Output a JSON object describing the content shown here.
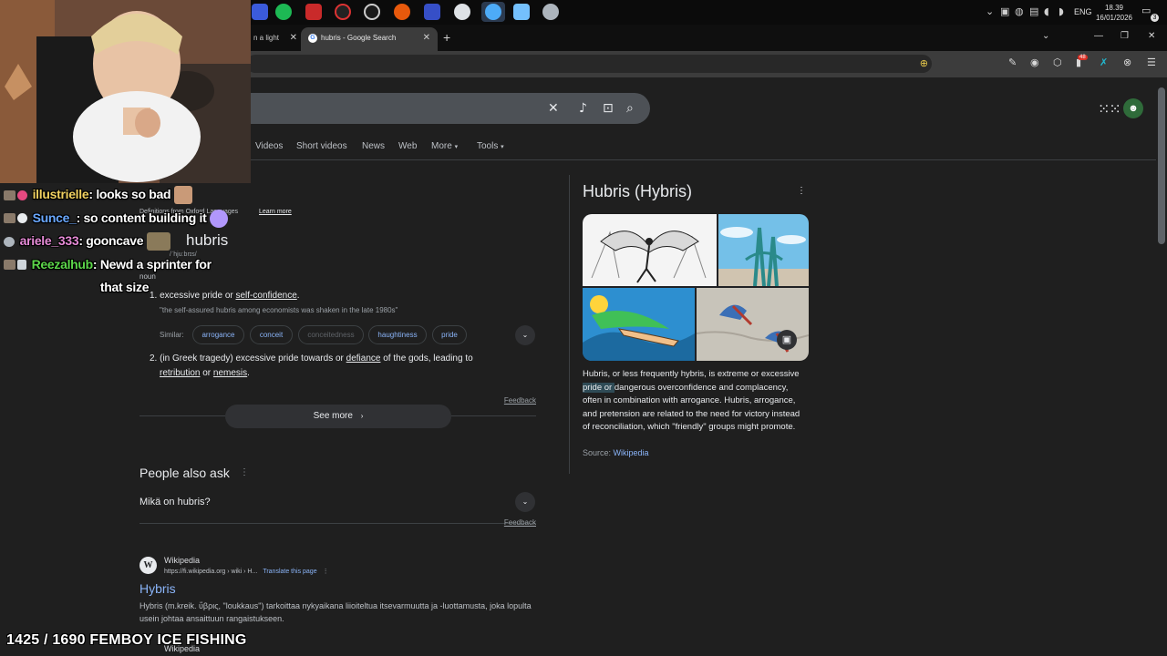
{
  "system": {
    "lang": "ENG",
    "time": "18.39",
    "date": "16/01/2026",
    "notification_count": "3"
  },
  "browser": {
    "tabs": [
      {
        "title": "n a light"
      },
      {
        "title": "hubris - Google Search"
      }
    ],
    "new_tab": "+",
    "extension_badge": "48"
  },
  "google": {
    "nav": [
      "Videos",
      "Short videos",
      "News",
      "Web",
      "More",
      "Tools"
    ],
    "dictionary": {
      "source_text": "Definitions from Oxford Languages",
      "learn_more": "Learn more",
      "word": "hubris",
      "pronunciation": "/ˈhjuːbrɪs/",
      "part_of_speech": "noun",
      "def1_prefix": "1. excessive pride or ",
      "def1_link": "self-confidence",
      "def1_suffix": ".",
      "example": "\"the self-assured hubris among economists was shaken in the late 1980s\"",
      "similar_label": "Similar:",
      "similar": [
        "arrogance",
        "conceit",
        "conceitedness",
        "haughtiness",
        "pride"
      ],
      "def2_a": "2. (in Greek tragedy) excessive pride towards or ",
      "def2_link1": "defiance",
      "def2_b": " of the gods, leading to",
      "def2_link2": "retribution",
      "def2_c": " or ",
      "def2_link3": "nemesis",
      "def2_d": ".",
      "feedback": "Feedback",
      "see_more": "See more"
    },
    "paa": {
      "title": "People also ask",
      "question": "Mikä on hubris?",
      "feedback": "Feedback"
    },
    "result": {
      "site_name": "Wikipedia",
      "url": "https://fi.wikipedia.org › wiki › H...",
      "translate": "Translate this page",
      "title": "Hybris",
      "snippet": "Hybris (m.kreik. ὕβρις, \"loukkaus\") tarkoittaa nykyaikana liioiteltua itsevarmuutta ja -luottamusta, joka lopulta usein johtaa ansaittuun rangaistukseen.",
      "next_site_name": "Wikipedia"
    },
    "knowledge_panel": {
      "title": "Hubris (Hybris)",
      "desc_a": "Hubris, or less frequently hybris, is extreme or excessive ",
      "desc_highlight": "pride or ",
      "desc_b": "dangerous overconfidence and complacency, often in combination with arrogance. Hubris, arrogance, and pretension are related to the need for victory instead of reconciliation, which \"friendly\" groups might promote.",
      "source_label": "Source: ",
      "source_link": "Wikipedia"
    }
  },
  "stream": {
    "chat": [
      {
        "user": "illustrielle",
        "color": "#f0d060",
        "message": "looks so bad"
      },
      {
        "user": "Sunce_",
        "color": "#6aa8ff",
        "message": "so content building it"
      },
      {
        "user": "ariele_333",
        "color": "#e58ad6",
        "message": "gooncave"
      },
      {
        "user": "Reezalhub",
        "color": "#5cd64a",
        "message": "Newd a sprinter for that size"
      }
    ],
    "goal": "1425 / 1690 FEMBOY ICE FISHING"
  }
}
